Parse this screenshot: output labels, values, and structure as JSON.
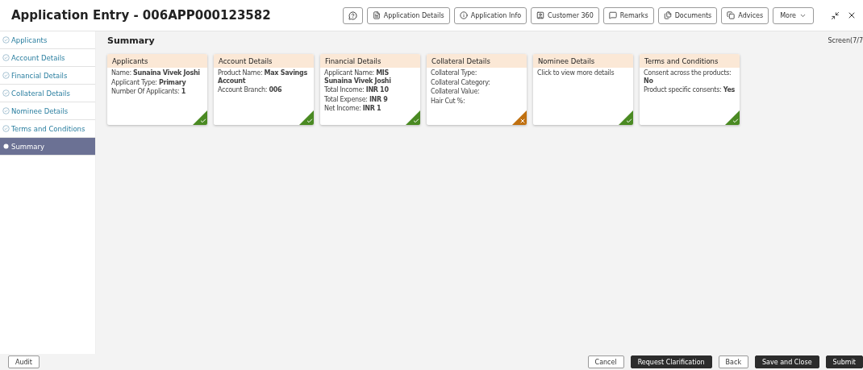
{
  "header": {
    "title": "Application Entry - 006APP000123582",
    "buttons": [
      {
        "label": "Application Details"
      },
      {
        "label": "Application Info"
      },
      {
        "label": "Customer 360"
      },
      {
        "label": "Remarks"
      },
      {
        "label": "Documents"
      },
      {
        "label": "Advices"
      }
    ],
    "more": "More"
  },
  "sidebar": {
    "items": [
      {
        "label": "Applicants",
        "selected": false
      },
      {
        "label": "Account Details",
        "selected": false
      },
      {
        "label": "Financial Details",
        "selected": false
      },
      {
        "label": "Collateral Details",
        "selected": false
      },
      {
        "label": "Nominee Details",
        "selected": false
      },
      {
        "label": "Terms and Conditions",
        "selected": false
      },
      {
        "label": "Summary",
        "selected": true
      }
    ]
  },
  "main": {
    "title": "Summary",
    "screen": "Screen(7/7",
    "cards": [
      {
        "title": "Applicants",
        "complete": true,
        "lines": [
          "Name: **Sunaina Vivek Joshi**",
          "Applicant Type: **Primary**",
          "Number Of Applicants: **1**"
        ]
      },
      {
        "title": "Account Details",
        "complete": true,
        "lines": [
          "Product Name: **Max Savings Account**",
          "Account Branch: **006**"
        ]
      },
      {
        "title": "Financial Details",
        "complete": true,
        "lines": [
          "Applicant Name: **MIS Sunaina Vivek Joshi**",
          "Total Income: **INR 10**",
          "Total Expense: **INR 9**",
          "Net Income: **INR 1**"
        ]
      },
      {
        "title": "Collateral Details",
        "complete": false,
        "lines": [
          "Collateral Type:",
          "Collateral Category:",
          "Collateral Value:",
          "Hair Cut %:"
        ]
      },
      {
        "title": "Nominee Details",
        "complete": true,
        "lines": [
          "Click to view more details"
        ]
      },
      {
        "title": "Terms and Conditions",
        "complete": true,
        "lines": [
          "Consent across the products: **No**",
          "Product specific consents: **Yes**"
        ]
      }
    ]
  },
  "footer": {
    "left": [
      {
        "label": "Audit",
        "kind": "outline"
      }
    ],
    "right": [
      {
        "label": "Cancel",
        "kind": "outline"
      },
      {
        "label": "Request Clarification",
        "kind": "dark"
      },
      {
        "label": "Back",
        "kind": "outline"
      },
      {
        "label": "Save and Close",
        "kind": "dark"
      },
      {
        "label": "Submit",
        "kind": "dark"
      }
    ]
  }
}
